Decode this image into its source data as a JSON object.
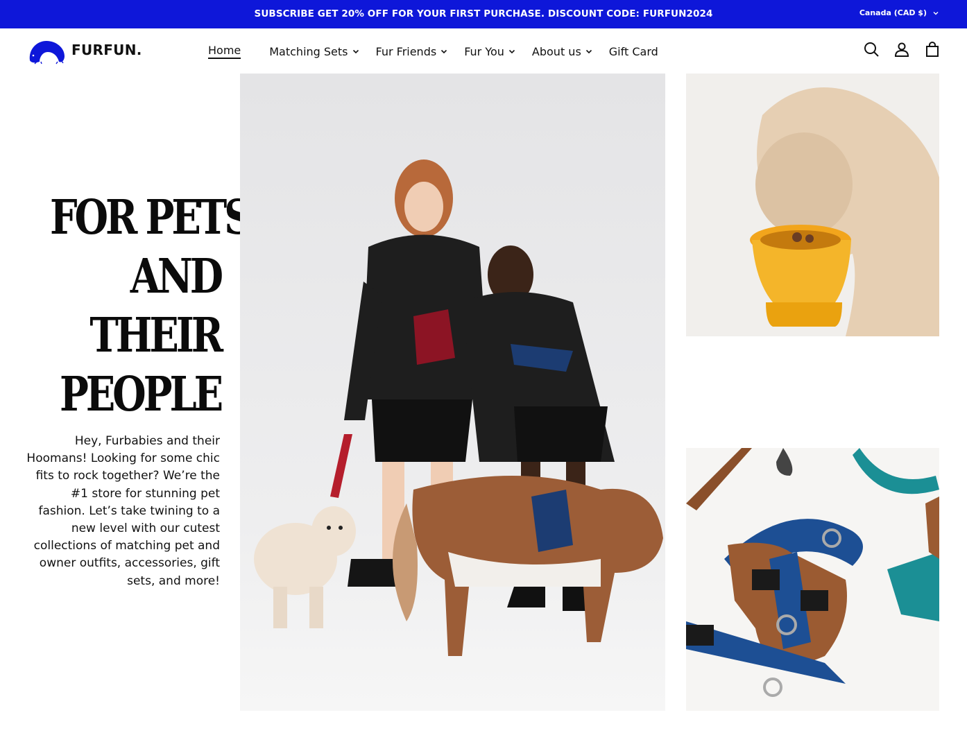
{
  "announcement": {
    "text": "SUBSCRIBE GET 20% OFF FOR YOUR FIRST PURCHASE. DISCOUNT CODE: FURFUN2024",
    "currency": "Canada (CAD $)"
  },
  "brand": {
    "name": "FURFUN."
  },
  "nav": {
    "items": [
      {
        "label": "Home",
        "active": true
      },
      {
        "label": "Matching Sets",
        "dropdown": true
      },
      {
        "label": "Fur Friends",
        "dropdown": true
      },
      {
        "label": "Fur You",
        "dropdown": true
      },
      {
        "label": "About us",
        "dropdown": true
      },
      {
        "label": "Gift Card"
      }
    ]
  },
  "header_icons": [
    "search-icon",
    "account-icon",
    "cart-icon"
  ],
  "hero": {
    "title_lines": [
      "FOR PETS",
      "AND",
      "THEIR",
      "PEOPLE"
    ],
    "body": "Hey, Furbabies and their Hoomans! Looking for some chic fits to rock together? We’re the #1 store for stunning pet fashion. Let’s take twining to a new level with our cutest collections of matching pet and owner outfits, accessories, gift sets, and more!"
  },
  "colors": {
    "brand_blue": "#0e17d9",
    "text": "#111111",
    "background": "#ffffff"
  }
}
